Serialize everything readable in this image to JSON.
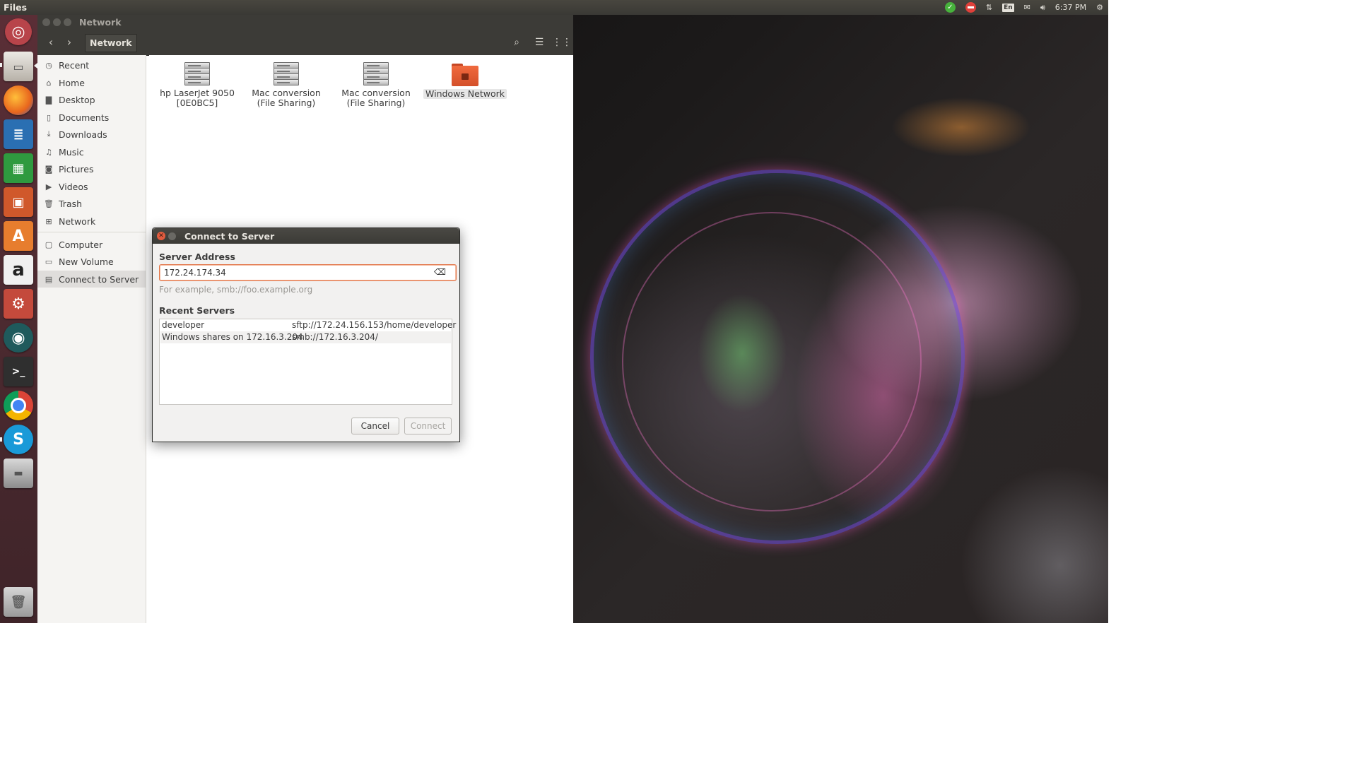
{
  "top_panel": {
    "app_title": "Files",
    "time": "6:37 PM",
    "keyboard_layout": "En",
    "tray_icons": [
      "update-check-icon",
      "network-blocked-icon",
      "network-transfer-icon",
      "keyboard-layout-icon",
      "mail-icon",
      "volume-icon",
      "clock",
      "settings-gear-icon"
    ]
  },
  "launcher": {
    "items": [
      {
        "name": "ubuntu-dash-icon",
        "color": "#b8444a"
      },
      {
        "name": "files-app-icon",
        "color": "#a8a29a"
      },
      {
        "name": "firefox-icon",
        "color": "#e8651d"
      },
      {
        "name": "libreoffice-writer-icon",
        "color": "#2a6fb2"
      },
      {
        "name": "libreoffice-calc-icon",
        "color": "#2f9a3f"
      },
      {
        "name": "libreoffice-impress-icon",
        "color": "#d0582b"
      },
      {
        "name": "ubuntu-software-icon",
        "color": "#e77d2e"
      },
      {
        "name": "amazon-icon",
        "color": "#f0f0f0"
      },
      {
        "name": "system-settings-icon",
        "color": "#c44a3c"
      },
      {
        "name": "gitkraken-icon",
        "color": "#1f5a5c"
      },
      {
        "name": "terminal-icon",
        "color": "#2f2f2f"
      },
      {
        "name": "chrome-icon",
        "color": "#e0e0e0"
      },
      {
        "name": "skype-icon",
        "color": "#1a9ad8"
      },
      {
        "name": "drive-icon",
        "color": "#9d9d9d"
      },
      {
        "name": "trash-icon",
        "color": "#b9b9b9"
      }
    ]
  },
  "files_window": {
    "title": "Network",
    "path_button": "Network",
    "sidebar": {
      "places": [
        {
          "label": "Recent",
          "icon": "clock-icon"
        },
        {
          "label": "Home",
          "icon": "home-icon"
        },
        {
          "label": "Desktop",
          "icon": "folder-icon"
        },
        {
          "label": "Documents",
          "icon": "document-icon"
        },
        {
          "label": "Downloads",
          "icon": "download-icon"
        },
        {
          "label": "Music",
          "icon": "music-icon"
        },
        {
          "label": "Pictures",
          "icon": "camera-icon"
        },
        {
          "label": "Videos",
          "icon": "video-icon"
        },
        {
          "label": "Trash",
          "icon": "trash-icon"
        },
        {
          "label": "Network",
          "icon": "network-icon"
        }
      ],
      "devices": [
        {
          "label": "Computer",
          "icon": "computer-icon"
        },
        {
          "label": "New Volume",
          "icon": "drive-icon"
        },
        {
          "label": "Connect to Server",
          "icon": "server-icon",
          "selected": true
        }
      ]
    },
    "items": [
      {
        "line1": "hp LaserJet 9050",
        "line2": "[0E0BC5]",
        "icon": "server-icon"
      },
      {
        "line1": "Mac conversion",
        "line2": "(File Sharing)",
        "icon": "server-icon"
      },
      {
        "line1": "Mac conversion",
        "line2": "(File Sharing)",
        "icon": "server-icon"
      },
      {
        "line1": "Windows Network",
        "line2": "",
        "icon": "windows-network-folder-icon"
      }
    ]
  },
  "dialog": {
    "title": "Connect to Server",
    "server_address_label": "Server Address",
    "server_address_value": "172.24.174.34",
    "hint": "For example, smb://foo.example.org",
    "recent_servers_label": "Recent Servers",
    "recent_servers": [
      {
        "name": "developer",
        "uri": "sftp://172.24.156.153/home/developer"
      },
      {
        "name": "Windows shares on 172.16.3.204",
        "uri": "smb://172.16.3.204/"
      }
    ],
    "cancel_label": "Cancel",
    "connect_label": "Connect"
  },
  "colors": {
    "accent": "#e95420",
    "panel": "#3c3b37",
    "sidebar_bg": "#f5f4f2",
    "launcher_bg": "#4c2a30"
  }
}
